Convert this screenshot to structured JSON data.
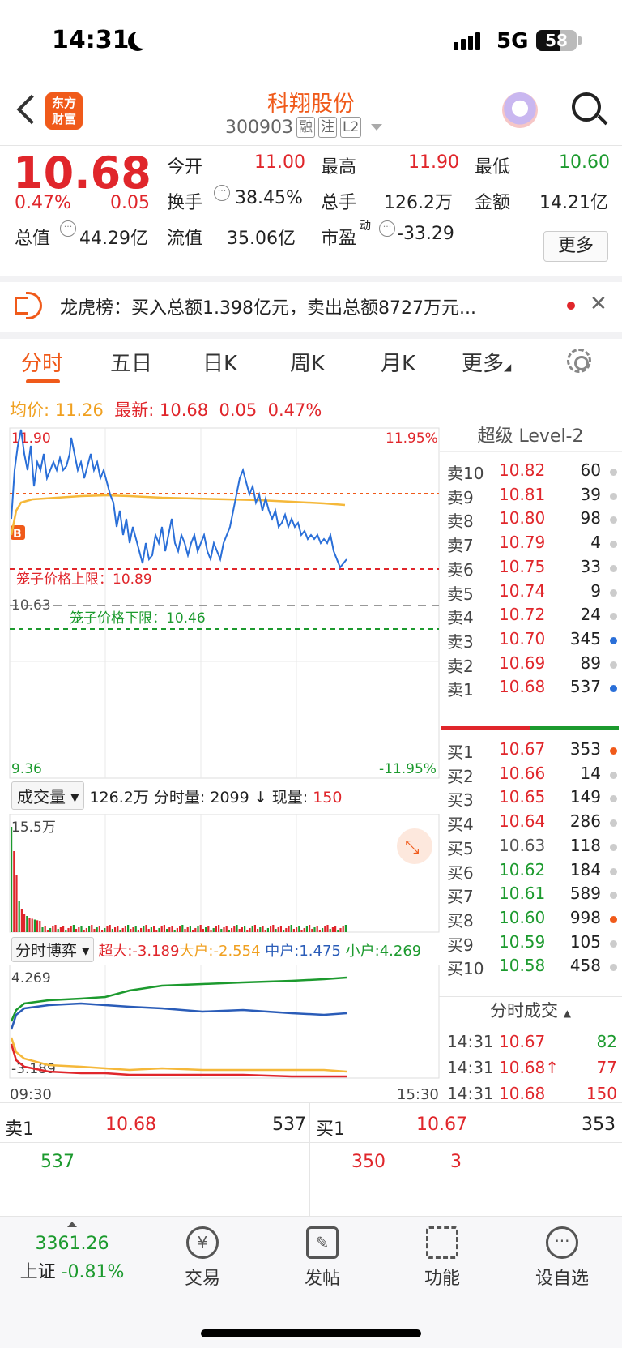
{
  "status_bar": {
    "time": "14:31",
    "network": "5G",
    "battery": "58"
  },
  "header": {
    "title": "科翔股份",
    "code": "300903",
    "tags": [
      "融",
      "注",
      "L2"
    ]
  },
  "quote": {
    "price": "10.68",
    "change_pct": "0.47%",
    "change": "0.05",
    "rows": [
      [
        {
          "k": "今开",
          "v": "11.00",
          "c": "red"
        },
        {
          "k": "最高",
          "v": "11.90",
          "c": "red"
        },
        {
          "k": "最低",
          "v": "10.60",
          "c": "green"
        }
      ],
      [
        {
          "k": "换手",
          "v": "38.45%",
          "c": "",
          "info": true
        },
        {
          "k": "总手",
          "v": "126.2万",
          "c": ""
        },
        {
          "k": "金额",
          "v": "14.21亿",
          "c": ""
        }
      ],
      [
        {
          "k": "总值",
          "v": "44.29亿",
          "c": "",
          "info": true
        },
        {
          "k": "流值",
          "v": "35.06亿",
          "c": ""
        },
        {
          "k": "市盈",
          "sup": "动",
          "v": "-33.29",
          "c": "",
          "info": true
        }
      ]
    ],
    "more_label": "更多"
  },
  "notice": {
    "text": "龙虎榜：买入总额1.398亿元，卖出总额8727万元..."
  },
  "tabs": {
    "items": [
      "分时",
      "五日",
      "日K",
      "周K",
      "月K",
      "更多"
    ],
    "active": 0
  },
  "summary": {
    "avg_label": "均价:",
    "avg": "11.26",
    "latest_label": "最新:",
    "latest": "10.68",
    "chg": "0.05",
    "pct": "0.47%"
  },
  "intraday": {
    "high_label": "11.90",
    "low_label": "9.36",
    "high_pct": "11.95%",
    "low_pct": "-11.95%",
    "ref_label": "10.63",
    "cage_upper": "笼子价格上限：10.89",
    "cage_lower": "笼子价格下限：10.46",
    "start_time": "09:30",
    "end_time": "15:30"
  },
  "volume_bar": {
    "selector": "成交量",
    "total": "126.2万",
    "label1": "分时量:",
    "v1": "2099",
    "arrow": "↓",
    "label2": "现量:",
    "v2": "150",
    "max": "15.5万"
  },
  "flow_bar": {
    "selector": "分时博弈",
    "items": [
      {
        "k": "超大:",
        "v": "-3.189",
        "color": "#e0262b"
      },
      {
        "k": "大户:",
        "v": "-2.554",
        "color": "#f0a020"
      },
      {
        "k": "中户:",
        "v": "1.475",
        "color": "#2a5cb8"
      },
      {
        "k": "小户:",
        "v": "4.269",
        "color": "#1c9a2e"
      }
    ],
    "top_label": "4.269",
    "bottom_label": "-3.189"
  },
  "orderbook": {
    "title": "超级 Level-2",
    "asks": [
      {
        "l": "卖10",
        "p": "10.82",
        "v": "60",
        "dot": "#ccc"
      },
      {
        "l": "卖9",
        "p": "10.81",
        "v": "39",
        "dot": "#ccc"
      },
      {
        "l": "卖8",
        "p": "10.80",
        "v": "98",
        "dot": "#ccc"
      },
      {
        "l": "卖7",
        "p": "10.79",
        "v": "4",
        "dot": "#ccc"
      },
      {
        "l": "卖6",
        "p": "10.75",
        "v": "33",
        "dot": "#ccc"
      },
      {
        "l": "卖5",
        "p": "10.74",
        "v": "9",
        "dot": "#ccc"
      },
      {
        "l": "卖4",
        "p": "10.72",
        "v": "24",
        "dot": "#ccc"
      },
      {
        "l": "卖3",
        "p": "10.70",
        "v": "345",
        "dot": "#2a6fd8"
      },
      {
        "l": "卖2",
        "p": "10.69",
        "v": "89",
        "dot": "#ccc"
      },
      {
        "l": "卖1",
        "p": "10.68",
        "v": "537",
        "dot": "#2a6fd8"
      }
    ],
    "bids": [
      {
        "l": "买1",
        "p": "10.67",
        "v": "353",
        "dot": "#f05a1a",
        "c": "red"
      },
      {
        "l": "买2",
        "p": "10.66",
        "v": "14",
        "dot": "#ccc",
        "c": "red"
      },
      {
        "l": "买3",
        "p": "10.65",
        "v": "149",
        "dot": "#ccc",
        "c": "red"
      },
      {
        "l": "买4",
        "p": "10.64",
        "v": "286",
        "dot": "#ccc",
        "c": "red"
      },
      {
        "l": "买5",
        "p": "10.63",
        "v": "118",
        "dot": "#ccc",
        "c": "gray"
      },
      {
        "l": "买6",
        "p": "10.62",
        "v": "184",
        "dot": "#ccc",
        "c": "green"
      },
      {
        "l": "买7",
        "p": "10.61",
        "v": "589",
        "dot": "#ccc",
        "c": "green"
      },
      {
        "l": "买8",
        "p": "10.60",
        "v": "998",
        "dot": "#f05a1a",
        "c": "green"
      },
      {
        "l": "买9",
        "p": "10.59",
        "v": "105",
        "dot": "#ccc",
        "c": "green"
      },
      {
        "l": "买10",
        "p": "10.58",
        "v": "458",
        "dot": "#ccc",
        "c": "green"
      }
    ],
    "trades_title": "分时成交",
    "trades": [
      {
        "t": "14:31",
        "p": "10.67",
        "v": "82",
        "vc": "green"
      },
      {
        "t": "14:31",
        "p": "10.68↑",
        "v": "77",
        "vc": "red"
      },
      {
        "t": "14:31",
        "p": "10.68",
        "v": "150",
        "vc": "red"
      }
    ]
  },
  "bottom_quote": {
    "sell_label": "卖1",
    "sell_price": "10.68",
    "sell_vol": "537",
    "buy_label": "买1",
    "buy_price": "10.67",
    "buy_vol": "353",
    "sell_detail": "537",
    "buy_detail1": "350",
    "buy_detail2": "3"
  },
  "bottom_nav": {
    "index_value": "3361.26",
    "index_name": "上证",
    "index_pct": "-0.81%",
    "items": [
      "交易",
      "发帖",
      "功能",
      "设自选"
    ]
  },
  "colors": {
    "brand": "#f05a1a",
    "up": "#e0262b",
    "down": "#1c9a2e",
    "price_line": "#2a6fd8",
    "avg_line": "#f5b83a"
  }
}
